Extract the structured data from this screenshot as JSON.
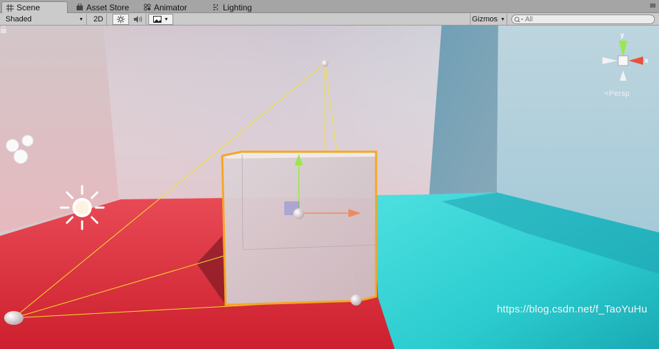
{
  "tabs": [
    {
      "label": "Scene",
      "icon": "grid-icon",
      "active": true
    },
    {
      "label": "Asset Store",
      "icon": "store-bag-icon",
      "active": false
    },
    {
      "label": "Animator",
      "icon": "animator-nodes-icon",
      "active": false
    },
    {
      "label": "Lighting",
      "icon": "lighting-icon",
      "active": false
    }
  ],
  "toolbar": {
    "draw_mode": "Shaded",
    "mode_2d": "2D",
    "gizmos": "Gizmos",
    "search_placeholder": "All"
  },
  "viewport": {
    "projection_label": "Persp",
    "gizmo_axes": {
      "y": "y",
      "x": "x"
    },
    "watermark": "https://blog.csdn.net/f_TaoYuHu"
  },
  "colors": {
    "floor_red": "#e02a3a",
    "floor_cyan": "#2fd2d2",
    "selection_outline": "#f5a623",
    "axis_y": "#9be84a",
    "axis_x": "#f08a5d",
    "gizmo_lines": "#f2e22a"
  }
}
